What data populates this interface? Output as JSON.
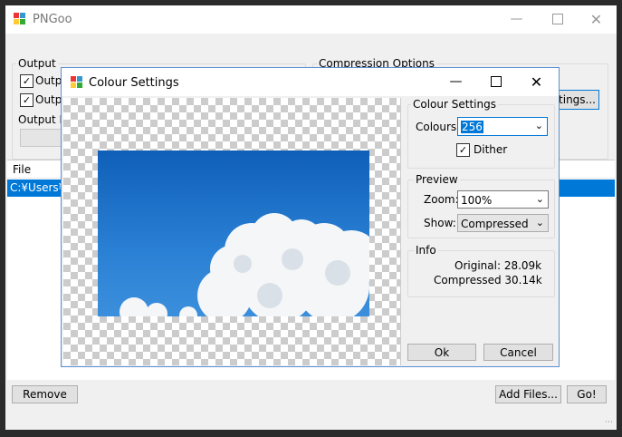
{
  "main_window": {
    "title": "PNGoo",
    "output_group": {
      "label": "Output",
      "checkbox1_label": "Output",
      "checkbox2_label": "Outpu",
      "output_dir_label": "Output D"
    },
    "compression_group": {
      "label": "Compression Options",
      "settings_button": "ettings..."
    },
    "file_list": {
      "header": "File",
      "rows": [
        "C:¥Users¥c"
      ]
    },
    "remove_button": "Remove",
    "add_files_button": "Add Files...",
    "go_button": "Go!"
  },
  "dialog": {
    "title": "Colour Settings",
    "colour_settings": {
      "label": "Colour Settings",
      "colours_label": "Colours:",
      "colours_value": "256",
      "dither_label": "Dither",
      "dither_checked": true
    },
    "preview": {
      "label": "Preview",
      "zoom_label": "Zoom:",
      "zoom_value": "100%",
      "show_label": "Show:",
      "show_value": "Compressed"
    },
    "info": {
      "label": "Info",
      "original": "Original: 28.09k",
      "compressed": "Compressed 30.14k"
    },
    "ok_button": "Ok",
    "cancel_button": "Cancel"
  },
  "colors": {
    "selection_blue": "#0078d7",
    "sky_blue": "#1f6fc4"
  }
}
